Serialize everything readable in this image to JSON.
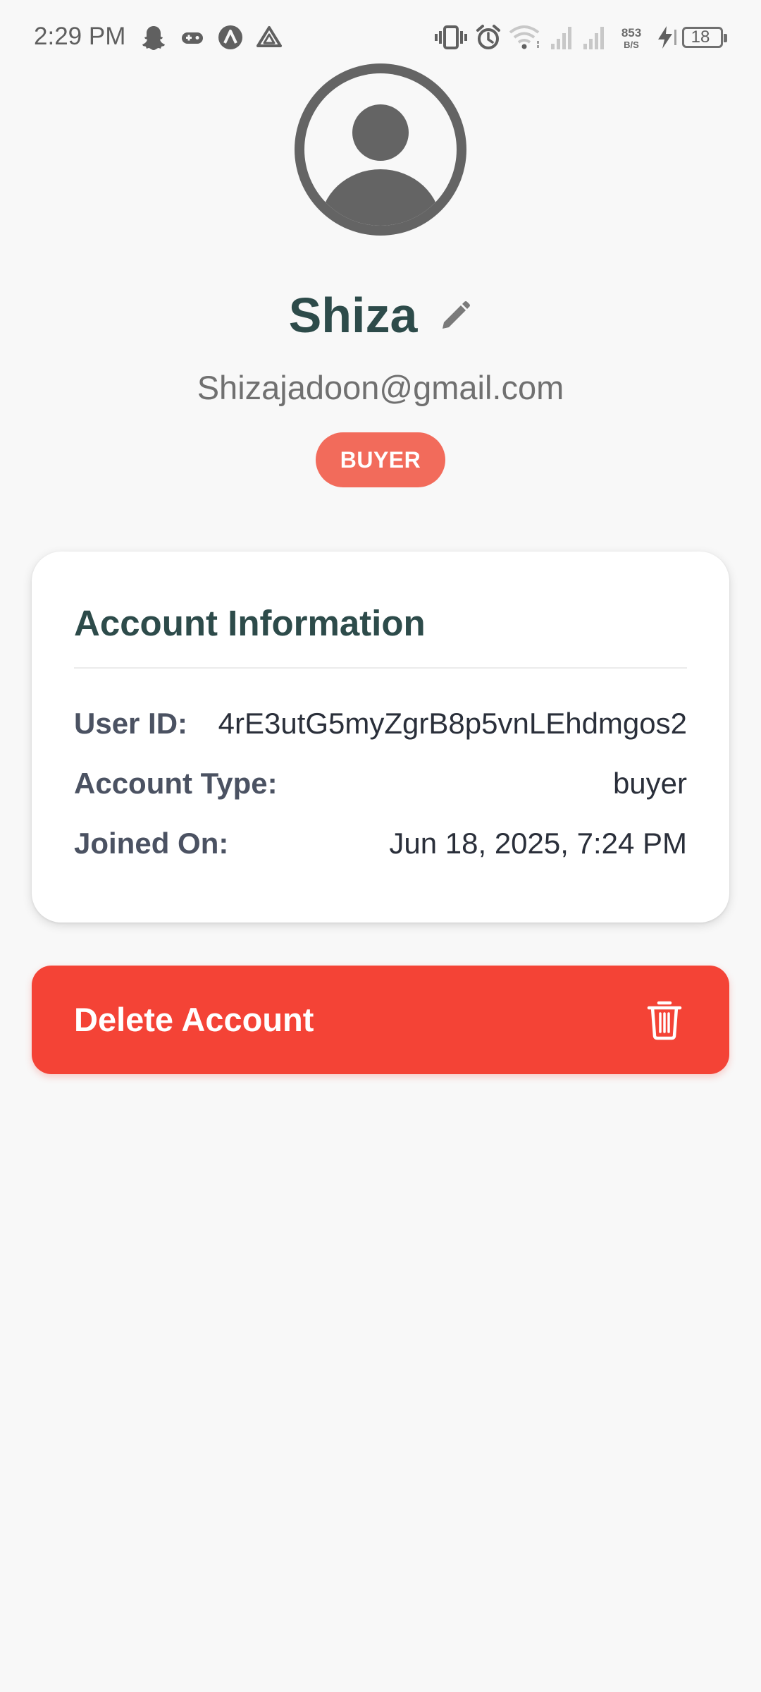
{
  "status_bar": {
    "time": "2:29 PM",
    "notification_icons": [
      "snapchat-icon",
      "game-controller-icon",
      "arc-app-icon",
      "drive-icon"
    ],
    "system_icons": [
      "vibrate-icon",
      "alarm-icon",
      "wifi-icon",
      "signal-icon",
      "signal-icon",
      "charging-icon"
    ],
    "net_speed_value": "853",
    "net_speed_unit": "B/S",
    "battery_level": "18"
  },
  "profile": {
    "name": "Shiza",
    "email": "Shizajadoon@gmail.com",
    "role_badge": "BUYER",
    "avatar_icon": "account-circle-icon",
    "edit_icon": "pencil-icon"
  },
  "account_info": {
    "title": "Account Information",
    "rows": [
      {
        "label": "User ID:",
        "value": "4rE3utG5myZgrB8p5vnLEhdmgos2"
      },
      {
        "label": "Account Type:",
        "value": "buyer"
      },
      {
        "label": "Joined On:",
        "value": "Jun 18, 2025, 7:24 PM"
      }
    ]
  },
  "delete_button": {
    "label": "Delete Account",
    "icon": "trash-icon"
  },
  "colors": {
    "background": "#f8f8f8",
    "heading": "#2d4b4a",
    "badge": "#f26b5b",
    "danger": "#f44336",
    "label": "#4b5262",
    "muted": "#707070"
  }
}
